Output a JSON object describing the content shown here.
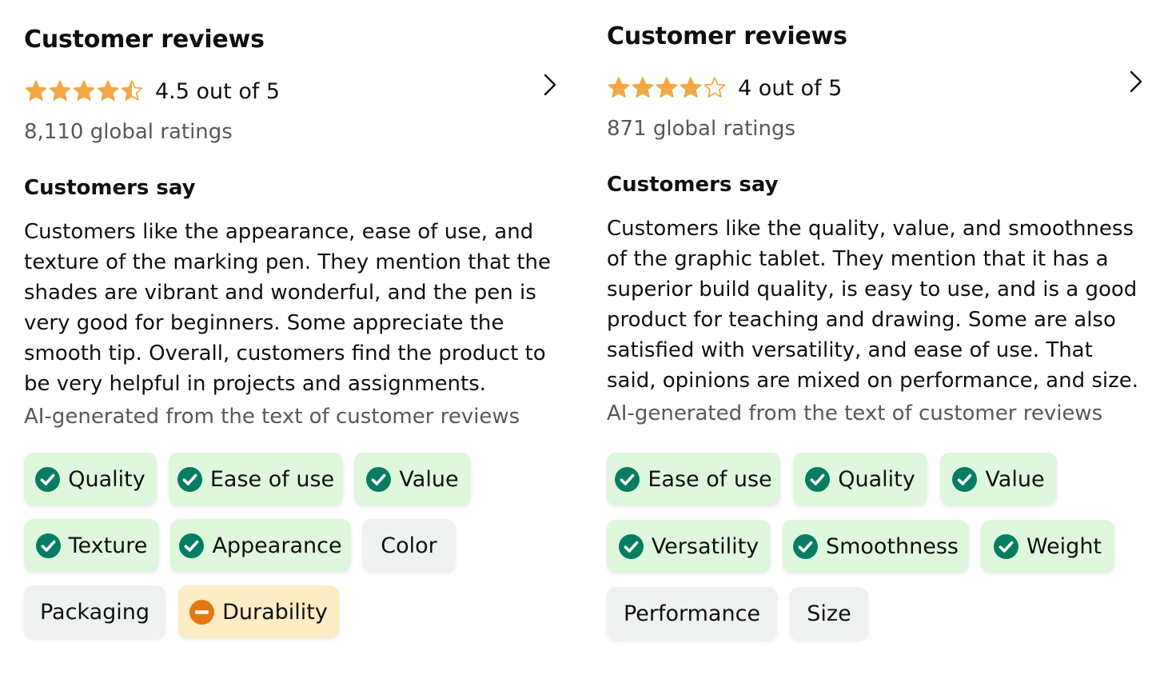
{
  "colors": {
    "star": "#f3a847",
    "positive_bg": "#dff7dd",
    "positive_icon": "#067d62",
    "neutral_bg": "#f0f2f2",
    "mixed_bg": "#fdecc4",
    "mixed_icon": "#e47911",
    "muted_text": "#565959"
  },
  "left": {
    "title": "Customer reviews",
    "stars": [
      "full",
      "full",
      "full",
      "full",
      "half"
    ],
    "rating_text": "4.5 out of 5",
    "global_ratings": "8,110 global ratings",
    "customers_say_heading": "Customers say",
    "summary": "Customers like the appearance, ease of use, and texture of the marking pen. They mention that the shades are vibrant and wonderful, and the pen is very good for beginners. Some appreciate the smooth tip. Overall, customers find the product to be very helpful in projects and assignments.",
    "ai_note": "AI-generated from the text of customer reviews",
    "aspects": [
      {
        "label": "Quality",
        "sentiment": "positive",
        "icon": "check-circle-icon"
      },
      {
        "label": "Ease of use",
        "sentiment": "positive",
        "icon": "check-circle-icon"
      },
      {
        "label": "Value",
        "sentiment": "positive",
        "icon": "check-circle-icon"
      },
      {
        "label": "Texture",
        "sentiment": "positive",
        "icon": "check-circle-icon"
      },
      {
        "label": "Appearance",
        "sentiment": "positive",
        "icon": "check-circle-icon"
      },
      {
        "label": "Color",
        "sentiment": "neutral",
        "icon": ""
      },
      {
        "label": "Packaging",
        "sentiment": "neutral",
        "icon": ""
      },
      {
        "label": "Durability",
        "sentiment": "mixed",
        "icon": "minus-circle-icon"
      }
    ]
  },
  "right": {
    "title": "Customer reviews",
    "stars": [
      "full",
      "full",
      "full",
      "full",
      "empty"
    ],
    "rating_text": "4 out of 5",
    "global_ratings": "871 global ratings",
    "customers_say_heading": "Customers say",
    "summary": "Customers like the quality, value, and smoothness of the graphic tablet. They mention that it has a superior build quality, is easy to use, and is a good product for teaching and drawing. Some are also satisfied with versatility, and ease of use. That said, opinions are mixed on performance, and size.",
    "ai_note": "AI-generated from the text of customer reviews",
    "aspects": [
      {
        "label": "Ease of use",
        "sentiment": "positive",
        "icon": "check-circle-icon"
      },
      {
        "label": "Quality",
        "sentiment": "positive",
        "icon": "check-circle-icon"
      },
      {
        "label": "Value",
        "sentiment": "positive",
        "icon": "check-circle-icon"
      },
      {
        "label": "Versatility",
        "sentiment": "positive",
        "icon": "check-circle-icon"
      },
      {
        "label": "Smoothness",
        "sentiment": "positive",
        "icon": "check-circle-icon"
      },
      {
        "label": "Weight",
        "sentiment": "positive",
        "icon": "check-circle-icon"
      },
      {
        "label": "Performance",
        "sentiment": "neutral",
        "icon": ""
      },
      {
        "label": "Size",
        "sentiment": "neutral",
        "icon": ""
      }
    ]
  }
}
